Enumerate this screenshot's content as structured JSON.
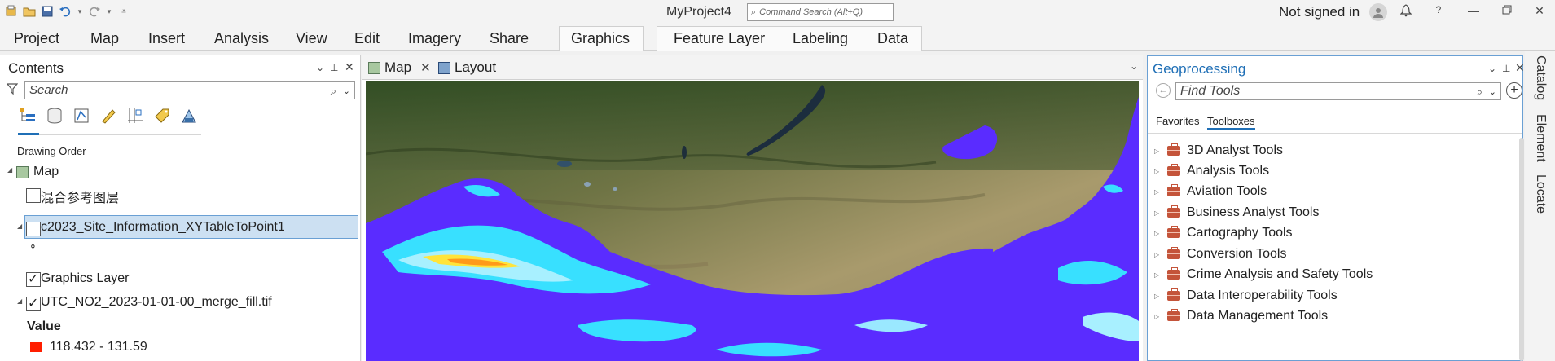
{
  "titlebar": {
    "app_title": "MyProject4",
    "command_search_placeholder": "Command Search (Alt+Q)",
    "signin_text": "Not signed in",
    "icons": [
      "new-project-icon",
      "open-project-icon",
      "save-icon",
      "undo-icon",
      "redo-icon",
      "customize-qat-icon",
      "notifications-bell-icon",
      "help-icon",
      "minimize-icon",
      "restore-icon",
      "close-icon"
    ]
  },
  "ribbon": {
    "tabs": [
      "Project",
      "Map",
      "Insert",
      "Analysis",
      "View",
      "Edit",
      "Imagery",
      "Share",
      "Graphics",
      "Feature Layer",
      "Labeling",
      "Data"
    ]
  },
  "contents": {
    "title": "Contents",
    "search_placeholder": "Search",
    "drawing_order_label": "Drawing Order",
    "tree": {
      "map_label": "Map",
      "layer1": "混合参考图层",
      "layer2": "c2023_Site_Information_XYTableToPoint1",
      "layer2_symbol": "∘",
      "layer3": "Graphics Layer",
      "layer4": "UTC_NO2_2023-01-01-00_merge_fill.tif",
      "value_heading": "Value",
      "legend_range": "118.432 - 131.59"
    },
    "layer_checked": {
      "layer1": false,
      "layer2": false,
      "layer3": true,
      "layer4": true
    },
    "legend_color": "#ff1e00"
  },
  "mapview": {
    "tabs": [
      "Map",
      "Layout"
    ]
  },
  "geoprocessing": {
    "title": "Geoprocessing",
    "search_placeholder": "Find Tools",
    "subtabs": [
      "Favorites",
      "Toolboxes"
    ],
    "active_subtab": "Toolboxes",
    "toolboxes": [
      "3D Analyst Tools",
      "Analysis Tools",
      "Aviation Tools",
      "Business Analyst Tools",
      "Cartography Tools",
      "Conversion Tools",
      "Crime Analysis and Safety Tools",
      "Data Interoperability Tools",
      "Data Management Tools"
    ]
  },
  "dock": {
    "tabs": [
      "Catalog",
      "Element",
      "Locate"
    ]
  },
  "colors": {
    "accent": "#1f6fb6",
    "selection": "#cce0f2",
    "no2_low": "#5a2cff",
    "no2_mid": "#38e0ff",
    "no2_high": "#ffe43a"
  }
}
